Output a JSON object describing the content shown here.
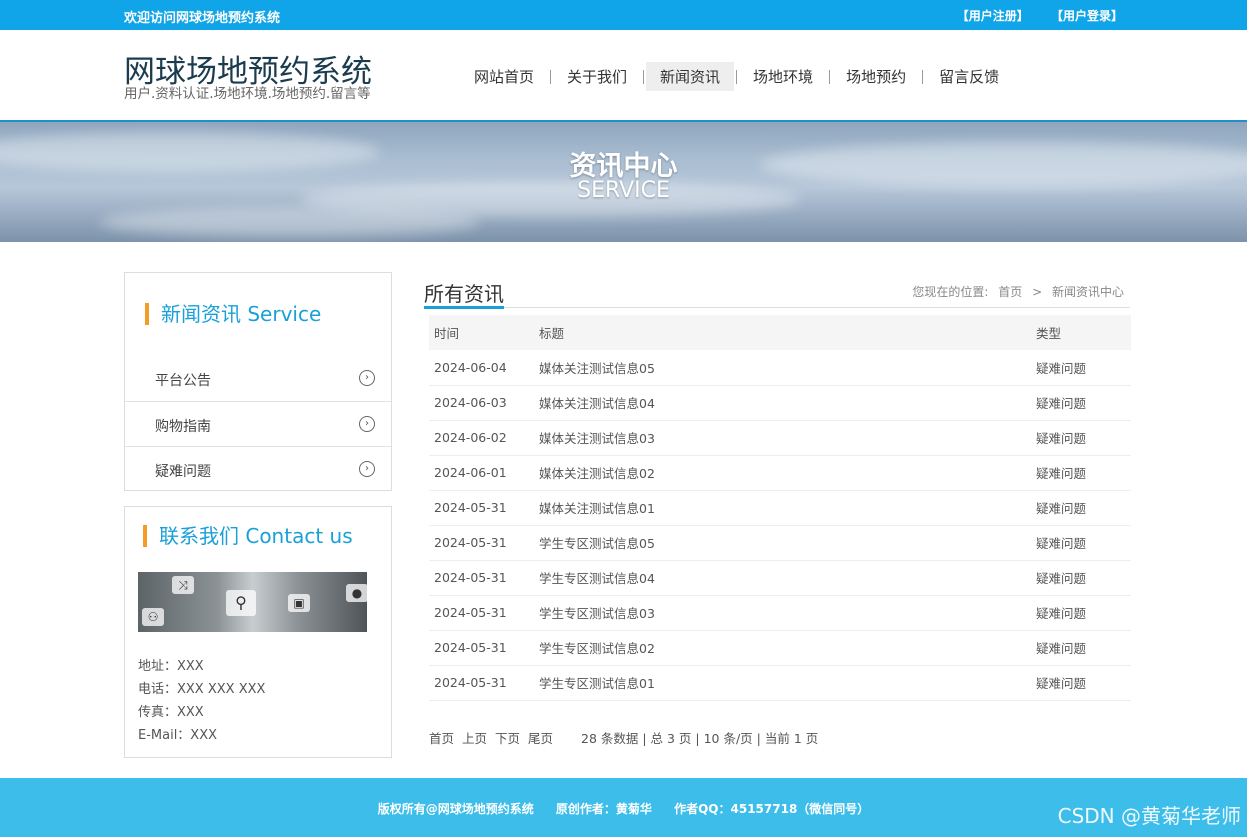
{
  "topbar": {
    "welcome": "欢迎访问网球场地预约系统",
    "register": "【用户注册】",
    "login": "【用户登录】"
  },
  "header": {
    "site_title": "网球场地预约系统",
    "site_subtitle": "用户.资料认证.场地环境.场地预约.留言等",
    "nav": [
      {
        "label": "网站首页",
        "active": false
      },
      {
        "label": "关于我们",
        "active": false
      },
      {
        "label": "新闻资讯",
        "active": true
      },
      {
        "label": "场地环境",
        "active": false
      },
      {
        "label": "场地预约",
        "active": false
      },
      {
        "label": "留言反馈",
        "active": false
      }
    ]
  },
  "banner": {
    "title": "资讯中心",
    "subtitle": "SERVICE"
  },
  "sidebar": {
    "news_heading": "新闻资讯 Service",
    "categories": [
      "平台公告",
      "购物指南",
      "疑难问题"
    ],
    "contact_heading": "联系我们 Contact us",
    "contact": {
      "address": "地址：XXX",
      "phone": "电话：XXX XXX XXX",
      "fax": "传真：XXX",
      "email": "E-Mail：XXX"
    }
  },
  "main": {
    "title": "所有资讯",
    "breadcrumb": {
      "prefix": "您现在的位置:",
      "home": "首页",
      "sep": ">",
      "current": "新闻资讯中心"
    },
    "table": {
      "headers": {
        "time": "时间",
        "title": "标题",
        "type": "类型"
      },
      "rows": [
        {
          "time": "2024-06-04",
          "title": "媒体关注测试信息05",
          "type": "疑难问题"
        },
        {
          "time": "2024-06-03",
          "title": "媒体关注测试信息04",
          "type": "疑难问题"
        },
        {
          "time": "2024-06-02",
          "title": "媒体关注测试信息03",
          "type": "疑难问题"
        },
        {
          "time": "2024-06-01",
          "title": "媒体关注测试信息02",
          "type": "疑难问题"
        },
        {
          "time": "2024-05-31",
          "title": "媒体关注测试信息01",
          "type": "疑难问题"
        },
        {
          "time": "2024-05-31",
          "title": "学生专区测试信息05",
          "type": "疑难问题"
        },
        {
          "time": "2024-05-31",
          "title": "学生专区测试信息04",
          "type": "疑难问题"
        },
        {
          "time": "2024-05-31",
          "title": "学生专区测试信息03",
          "type": "疑难问题"
        },
        {
          "time": "2024-05-31",
          "title": "学生专区测试信息02",
          "type": "疑难问题"
        },
        {
          "time": "2024-05-31",
          "title": "学生专区测试信息01",
          "type": "疑难问题"
        }
      ]
    },
    "pager": {
      "first": "首页",
      "prev": "上页",
      "next": "下页",
      "last": "尾页",
      "stats": "28 条数据 | 总 3 页 | 10 条/页 | 当前 1 页"
    }
  },
  "footer": {
    "copyright": "版权所有@网球场地预约系统",
    "author": "原创作者：黄菊华",
    "qq": "作者QQ：45157718（微信同号）"
  },
  "watermark": "CSDN @黄菊华老师",
  "colors": {
    "topbar": "#10a4e8",
    "footer": "#3cbdea",
    "accent": "#1aa0d9",
    "heading_bar": "#f49c25"
  }
}
